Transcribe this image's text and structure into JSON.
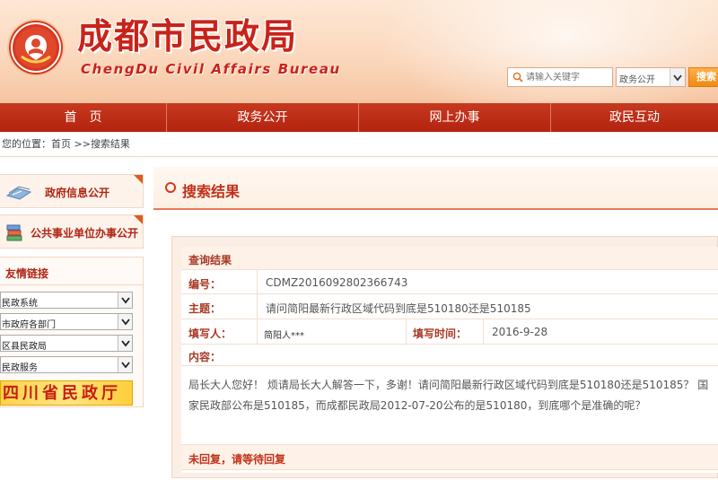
{
  "header": {
    "title": "成都市民政局",
    "subtitle": "ChengDu Civil Affairs Bureau",
    "search_placeholder": "请输入关键字",
    "search_scope": "政务公开",
    "search_button": "搜索",
    "colors": {
      "brand_red": "#c8231a",
      "nav_red": "#b3230f",
      "accent_orange": "#f08a12"
    }
  },
  "nav": {
    "items": [
      {
        "label": "首　页"
      },
      {
        "label": "政务公开"
      },
      {
        "label": "网上办事"
      },
      {
        "label": "政民互动"
      }
    ]
  },
  "breadcrumb": {
    "prefix": "您的位置：",
    "home": "首页",
    "sep": " >>",
    "current": "搜索结果"
  },
  "sidebar": {
    "boxes": [
      {
        "label": "政府信息公开",
        "icon": "documents-icon"
      },
      {
        "label": "公共事业单位办事公开",
        "icon": "book-stack-icon"
      }
    ],
    "friends_title": "友情链接",
    "friend_selects": [
      {
        "value": "民政系统"
      },
      {
        "value": "市政府各部门"
      },
      {
        "value": "区县民政局"
      },
      {
        "value": "民政服务"
      }
    ],
    "banner": "四川省民政厅"
  },
  "main": {
    "section_title": "搜索结果",
    "result": {
      "header": "查询结果",
      "number_label": "编号：",
      "number_value": "CDMZ2016092802366743",
      "subject_label": "主题：",
      "subject_value": "请问简阳最新行政区域代码到底是510180还是510185",
      "author_label": "填写人：",
      "author_value": "简阳人***",
      "time_label": "填写时间：",
      "time_value": "2016-9-28",
      "content_label": "内容：",
      "content_value": "局长大人您好！ 烦请局长大人解答一下，多谢！请问简阳最新行政区域代码到底是510180还是510185？ 国家民政部公布是510185，而成都民政局2012-07-20公布的是510180，到底哪个是准确的呢？",
      "reply_status": "未回复，请等待回复"
    }
  }
}
